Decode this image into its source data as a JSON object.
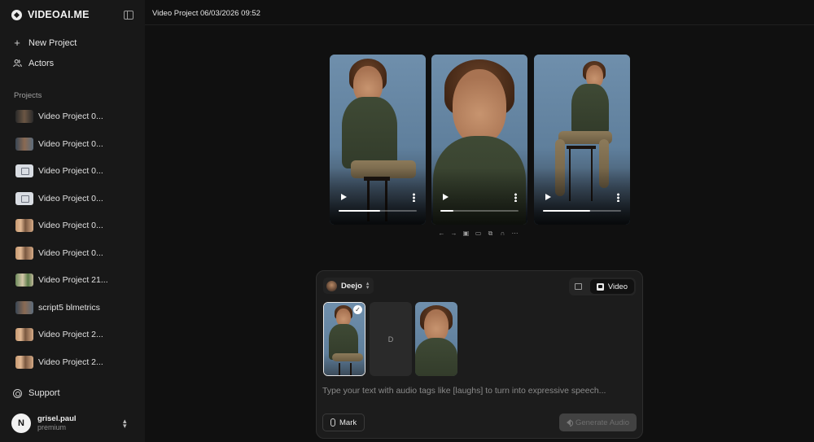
{
  "brand": {
    "name": "VIDEOAI.ME"
  },
  "nav": {
    "new_project": "New Project",
    "actors": "Actors"
  },
  "projects_label": "Projects",
  "projects": [
    {
      "label": "Video Project 0...",
      "thumb": "dark"
    },
    {
      "label": "Video Project 0...",
      "thumb": "photo2"
    },
    {
      "label": "Video Project 0...",
      "thumb": "placeholder"
    },
    {
      "label": "Video Project 0...",
      "thumb": "placeholder"
    },
    {
      "label": "Video Project 0...",
      "thumb": "photo3"
    },
    {
      "label": "Video Project 0...",
      "thumb": "photo3"
    },
    {
      "label": "Video Project 21...",
      "thumb": "photo4"
    },
    {
      "label": "script5 blmetrics",
      "thumb": "photo2"
    },
    {
      "label": "Video Project 2...",
      "thumb": "photo3"
    },
    {
      "label": "Video Project 2...",
      "thumb": "photo3"
    }
  ],
  "support": "Support",
  "user": {
    "initial": "N",
    "name": "grisel.paul",
    "plan": "premium"
  },
  "header": {
    "title": "Video Project 06/03/2026 09:52"
  },
  "videos": [
    {
      "shot": "seated",
      "progress": 0.53
    },
    {
      "shot": "closeup",
      "progress": 0.17
    },
    {
      "shot": "seated-wide",
      "progress": 0.6
    }
  ],
  "toolbar_icons": [
    "arrow-left-icon",
    "arrow-right-icon",
    "image-icon",
    "video-icon",
    "copy-icon",
    "headphones-icon",
    "more-icon"
  ],
  "composer": {
    "actor": "Deejo",
    "mode_video_label": "Video",
    "empty_frame_label": "D",
    "prompt_placeholder": "Type your text with audio tags like [laughs] to turn into expressive speech...",
    "mark_label": "Mark",
    "generate_label": "Generate Audio"
  }
}
